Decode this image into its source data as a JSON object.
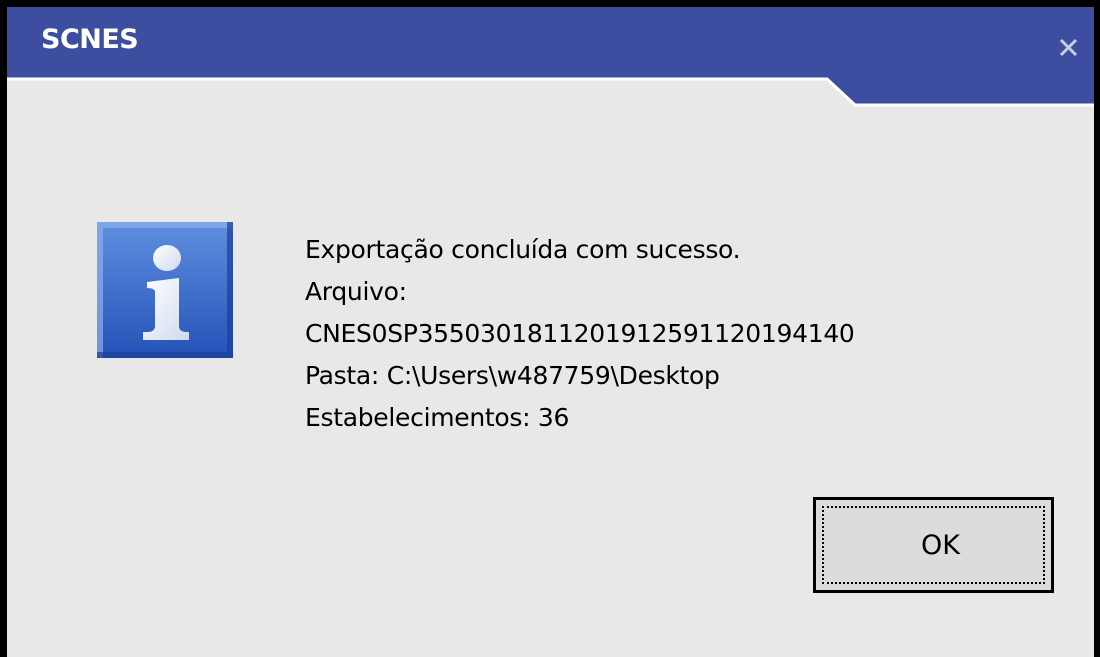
{
  "window": {
    "title": "SCNES"
  },
  "dialog": {
    "message_lines": [
      "Exportação concluída com sucesso.",
      "Arquivo:",
      "CNES0SP3550301811201912591120194140",
      "Pasta: C:\\Users\\w487759\\Desktop",
      "Estabelecimentos: 36"
    ],
    "ok_label": "OK",
    "icon": "info-icon"
  },
  "colors": {
    "titlebar_blue": "#3d4ea0",
    "background": "#e8e8e8",
    "icon_blue": "#2e64c4"
  }
}
